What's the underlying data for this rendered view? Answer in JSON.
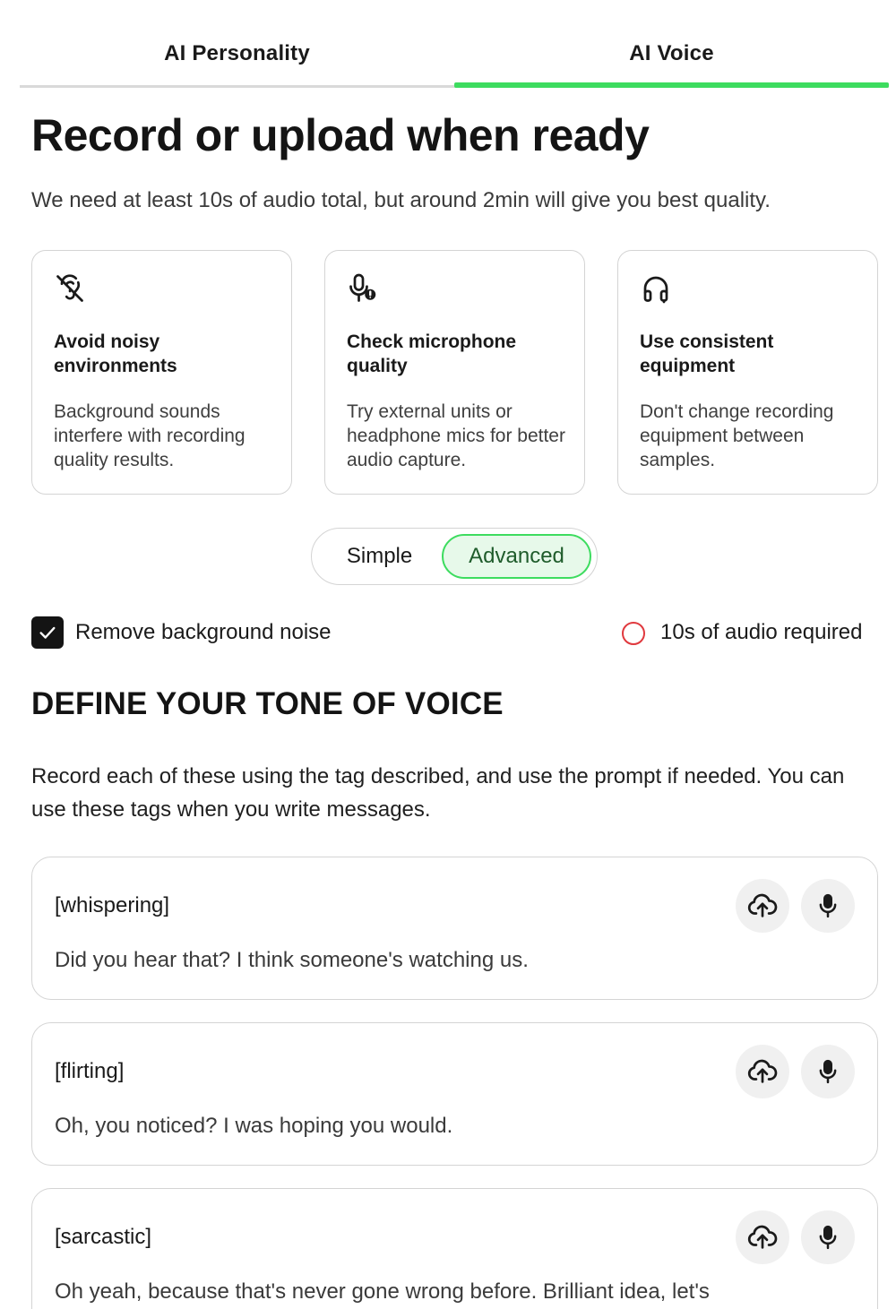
{
  "tabs": [
    {
      "label": "AI Personality",
      "active": false
    },
    {
      "label": "AI Voice",
      "active": true
    }
  ],
  "header": {
    "title": "Record or upload when ready",
    "subtitle": "We need at least 10s of audio total, but around 2min will give you best quality."
  },
  "tips": [
    {
      "icon": "ear-off-icon",
      "title": "Avoid noisy environments",
      "desc": "Background sounds interfere with recording quality results."
    },
    {
      "icon": "microphone-alert-icon",
      "title": "Check microphone quality",
      "desc": "Try external units or headphone mics for better audio capture."
    },
    {
      "icon": "headphones-icon",
      "title": "Use consistent equipment",
      "desc": "Don't change recording equipment between samples."
    }
  ],
  "mode": {
    "simple_label": "Simple",
    "advanced_label": "Advanced",
    "selected": "Advanced"
  },
  "options": {
    "remove_noise_label": "Remove background noise",
    "remove_noise_checked": true,
    "requirement_label": "10s of audio required"
  },
  "section": {
    "title": "DEFINE YOUR TONE OF VOICE",
    "instructions": "Record each of these using the tag described, and use the prompt if needed. You can use these tags when you write messages."
  },
  "tones": [
    {
      "tag": "[whispering]",
      "prompt": "Did you hear that? I think someone's watching us."
    },
    {
      "tag": "[flirting]",
      "prompt": "Oh, you noticed? I was hoping you would."
    },
    {
      "tag": "[sarcastic]",
      "prompt": "Oh yeah, because that's never gone wrong before. Brilliant idea, let's"
    }
  ],
  "colors": {
    "accent": "#3ddc5f",
    "accent_bg": "#e7f9ea",
    "required": "#e0393e",
    "text": "#1a1a1a"
  }
}
